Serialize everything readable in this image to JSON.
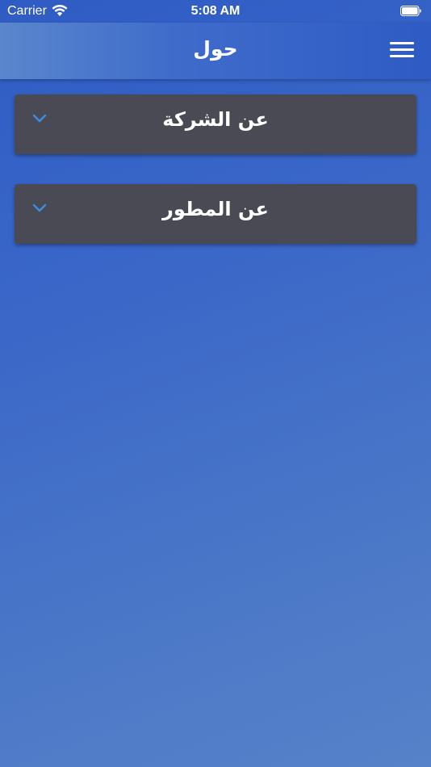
{
  "status_bar": {
    "carrier": "Carrier",
    "time": "5:08 AM"
  },
  "header": {
    "title": "حول"
  },
  "sections": [
    {
      "title": "عن الشركة"
    },
    {
      "title": "عن المطور"
    }
  ],
  "icons": {
    "wifi": "wifi-icon",
    "battery": "battery-icon",
    "menu": "hamburger-menu-icon",
    "chevron": "chevron-down-icon"
  },
  "colors": {
    "background_top": "#2f5cc4",
    "background_bottom": "#5682c9",
    "card": "#4a4a55",
    "chevron": "#3a8ee6",
    "text": "#ffffff"
  }
}
